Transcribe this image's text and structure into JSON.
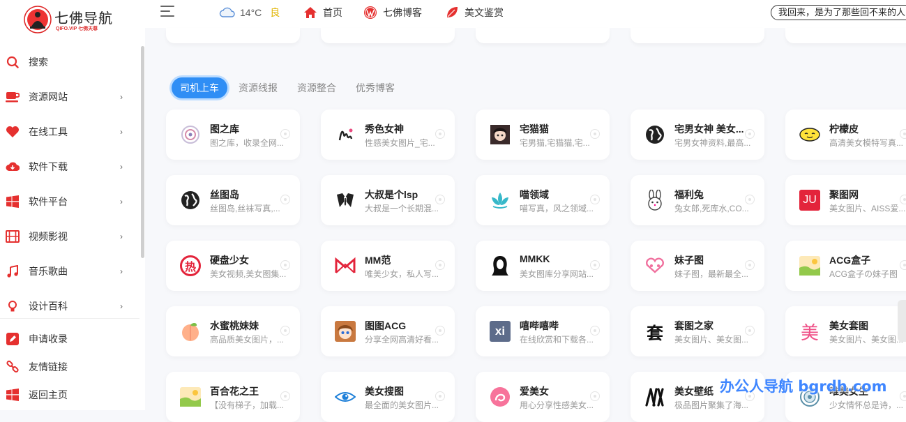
{
  "logo": {
    "title": "七佛导航",
    "subtitle": "QIFO.VIP 七佛天尊"
  },
  "sidebar": {
    "items": [
      {
        "label": "搜索",
        "icon": "search-icon",
        "has_children": false
      },
      {
        "label": "资源网站",
        "icon": "cup-icon",
        "has_children": true
      },
      {
        "label": "在线工具",
        "icon": "heart-icon",
        "has_children": true
      },
      {
        "label": "软件下载",
        "icon": "cloud-download-icon",
        "has_children": true
      },
      {
        "label": "软件平台",
        "icon": "windows-icon",
        "has_children": true
      },
      {
        "label": "视频影视",
        "icon": "film-icon",
        "has_children": true
      },
      {
        "label": "音乐歌曲",
        "icon": "music-icon",
        "has_children": true
      },
      {
        "label": "设计百科",
        "icon": "bulb-icon",
        "has_children": true
      }
    ],
    "bottom_items": [
      {
        "label": "申请收录",
        "icon": "edit-icon"
      },
      {
        "label": "友情链接",
        "icon": "link-icon"
      },
      {
        "label": "返回主页",
        "icon": "windows-icon"
      }
    ],
    "chevron": "›"
  },
  "topbar": {
    "weather": {
      "temp": "14°C",
      "air": "良",
      "icon": "cloud-icon"
    },
    "links": [
      {
        "label": "首页",
        "icon": "home-icon"
      },
      {
        "label": "七佛博客",
        "icon": "wordpress-icon"
      },
      {
        "label": "美文鉴赏",
        "icon": "leaf-icon"
      }
    ],
    "marquee": "我回来，是为了那些回不来的人"
  },
  "tabs": [
    "司机上车",
    "资源线报",
    "资源整合",
    "优秀博客"
  ],
  "active_tab": 0,
  "cards": [
    {
      "name": "图之库",
      "desc": "图之库，收录全网..."
    },
    {
      "name": "秀色女神",
      "desc": "性感美女图片_宅..."
    },
    {
      "name": "宅猫猫",
      "desc": "宅男猫,宅猫猫,宅..."
    },
    {
      "name": "宅男女神 美女...",
      "desc": "宅男女神资料,最高..."
    },
    {
      "name": "柠檬皮",
      "desc": "高清美女模特写真..."
    },
    {
      "name": "丝图岛",
      "desc": "丝图岛,丝袜写真,..."
    },
    {
      "name": "大叔是个lsp",
      "desc": "大叔是一个长期混..."
    },
    {
      "name": "喵领域",
      "desc": "喵写真，风之领域..."
    },
    {
      "name": "福利兔",
      "desc": "兔女郎,死库水,CO..."
    },
    {
      "name": "聚图网",
      "desc": "美女图片、AISS爱..."
    },
    {
      "name": "硬盘少女",
      "desc": "美女视频,美女图集..."
    },
    {
      "name": "MM范",
      "desc": "唯美少女，私人写..."
    },
    {
      "name": "MMKK",
      "desc": "美女图库分享网站..."
    },
    {
      "name": "妹子图",
      "desc": "妹子图，最新最全..."
    },
    {
      "name": "ACG盒子",
      "desc": "ACG盒子の妹子图"
    },
    {
      "name": "水蜜桃妹妹",
      "desc": "高品质美女图片，..."
    },
    {
      "name": "图图ACG",
      "desc": "分享全网高清好看..."
    },
    {
      "name": "嘻哔嘻哔",
      "desc": "在线欣赏和下载各..."
    },
    {
      "name": "套图之家",
      "desc": "美女图片、美女图..."
    },
    {
      "name": "美女套图",
      "desc": "美女图片、美女图..."
    },
    {
      "name": "百合花之王",
      "desc": "【没有梯子，加载..."
    },
    {
      "name": "美女搜图",
      "desc": "最全面的美女图片..."
    },
    {
      "name": "爱美女",
      "desc": "用心分享性感美女..."
    },
    {
      "name": "美女壁纸",
      "desc": "极品图片聚集了海..."
    },
    {
      "name": "唯美女生",
      "desc": "少女情怀总是诗，..."
    }
  ],
  "card_icon_text": {
    "ju": "JU",
    "xi": "xi",
    "tao": "套",
    "mei": "美",
    "re": "热"
  },
  "watermark": "办公人导航 bgrdh.com"
}
